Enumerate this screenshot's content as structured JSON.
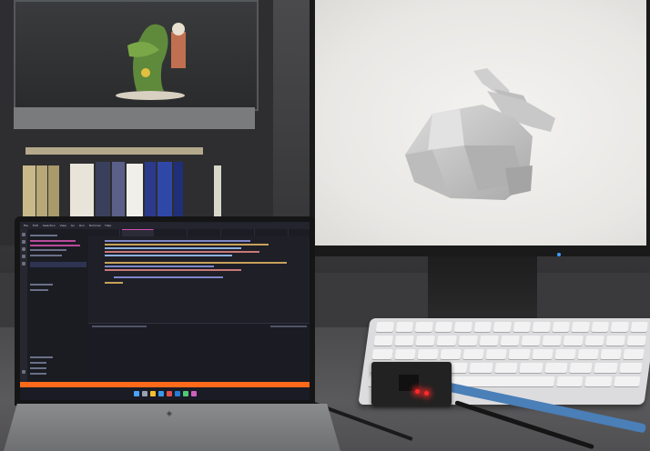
{
  "scene": {
    "monitor_render": "bunny-mesh",
    "laptop_brand_mark": "hp"
  },
  "vscode": {
    "menu": [
      "File",
      "Edit",
      "Selection",
      "View",
      "Go",
      "Run",
      "Terminal",
      "Help"
    ],
    "tabs_count": 6,
    "accent_color": "#d04fb0",
    "statusbar_color": "#ff6a1a"
  },
  "colors": {
    "monitor_bg": "#eeede9",
    "bunny": "#c9c9c9",
    "board_led": "#ff2a2a",
    "cable_blue": "#4a7fb8"
  }
}
